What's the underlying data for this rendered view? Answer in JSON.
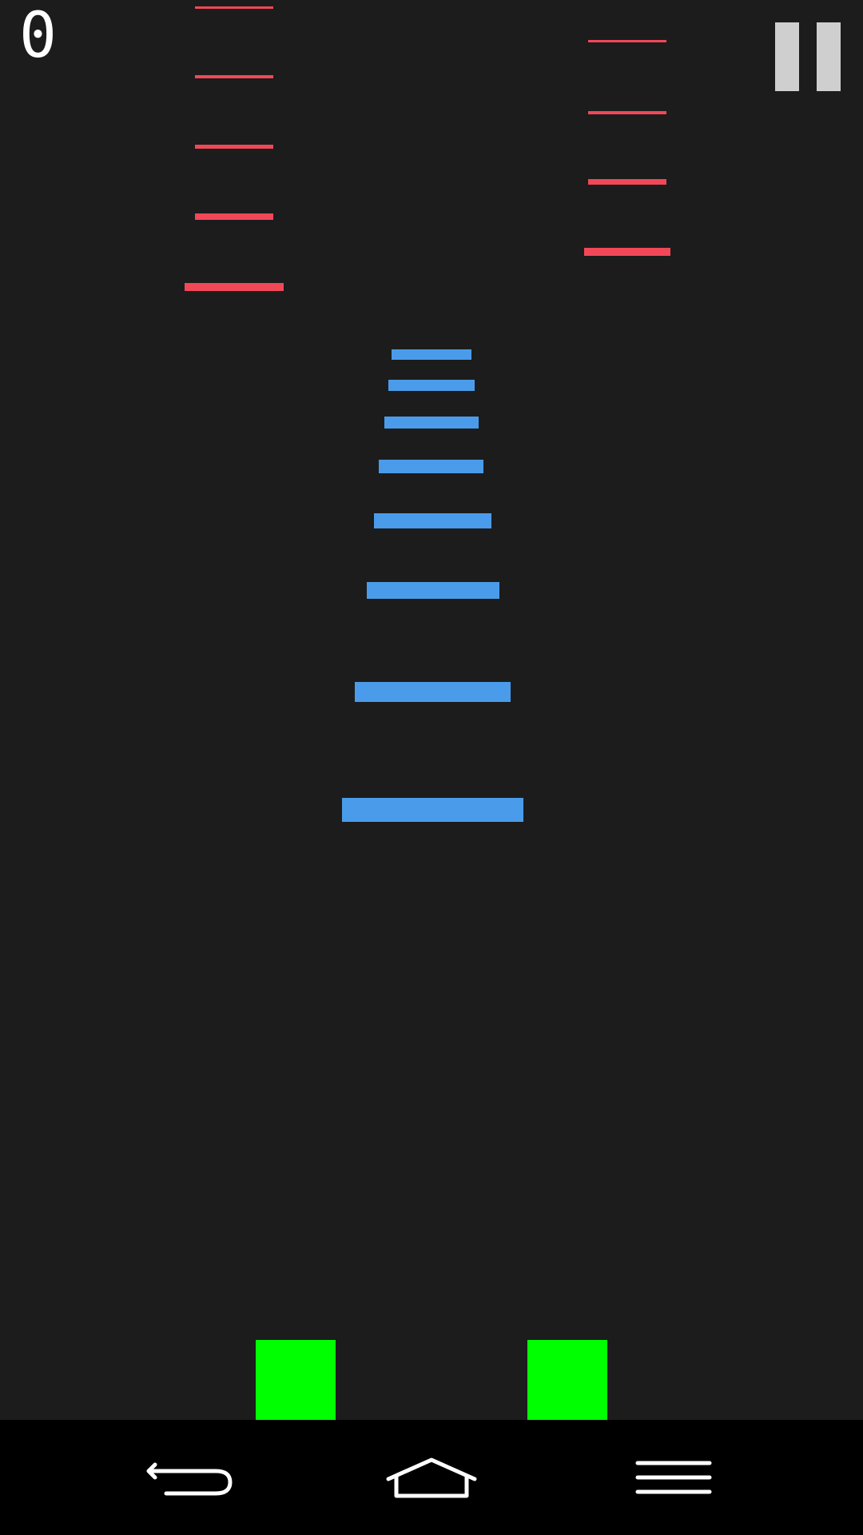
{
  "hud": {
    "score": "0",
    "pause_icon": "pause-icon"
  },
  "colors": {
    "background": "#1c1c1c",
    "hazard": "#f14858",
    "road_mark": "#4a9cea",
    "player": "#00ff00",
    "nav_bar": "#000000",
    "pause": "#cfcfcf"
  },
  "nav_bar": {
    "icons": [
      "back-icon",
      "home-icon",
      "menu-icon"
    ]
  }
}
